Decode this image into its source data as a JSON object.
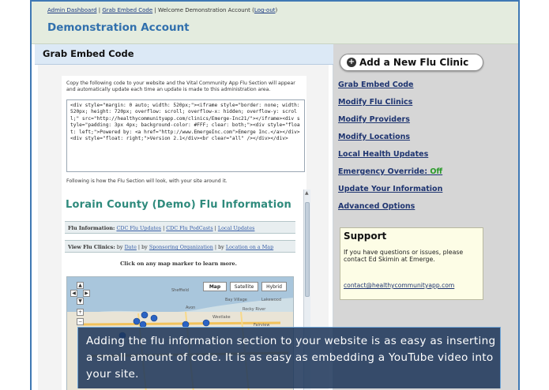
{
  "header": {
    "nav": {
      "admin_dashboard": "Admin Dashboard",
      "separator1": " | ",
      "grab_embed_code": "Grab Embed Code",
      "welcome": " | Welcome Demonstration Account (",
      "logout": "Log-out",
      "close": ")"
    },
    "account_title": "Demonstration Account"
  },
  "main": {
    "title": "Grab Embed Code",
    "instructions": "Copy the following code to your website and the Vital Community App Flu Section will appear and automatically update each time an update is made to this administration area.",
    "embed_code": "<div style=\"margin: 0 auto; width: 520px;\"><iframe style=\"border: none; width: 520px; height: 720px; overflow: scroll; overflow-x: hidden; overflow-y: scroll;\" src=\"http://healthycommunityapp.com/clinics/Emerge-Inc21/\"></iframe><div style=\"padding: 3px 4px; background-color: #FFF; clear: both;\"><div style=\"float: left;\">Powered by: <a href=\"http://www.EmergeInc.com\">Emerge Inc.</a></div><div style=\"float: right;\">Version 2.1</div><br clear=\"all\" /></div></div>",
    "preview_caption": "Following is how the Flu Section will look, with your site around it.",
    "preview": {
      "title": "Lorain County (Demo) Flu Information",
      "info_label": "Flu Information:",
      "info_links": [
        "CDC Flu Updates",
        "CDC Flu PodCasts",
        "Local Updates"
      ],
      "view_label": "View Flu Clinics:",
      "view_by": "by",
      "view_links": [
        "Date",
        "Sponsoring Organization",
        "Location on a Map"
      ],
      "map_hint": "Click on any map marker to learn more.",
      "map_buttons": [
        "Map",
        "Satellite",
        "Hybrid"
      ],
      "map_places": [
        "Sheffield",
        "Bay Village",
        "Lakewood",
        "Avon",
        "Rocky River",
        "Westlake",
        "Fairview"
      ]
    }
  },
  "sidebar": {
    "add_clinic_label": "Add a New Flu Clinic",
    "links": {
      "grab": "Grab Embed Code",
      "modify_clinics": "Modify Flu Clinics",
      "modify_providers": "Modify Providers",
      "modify_locations": "Modify Locations",
      "local_updates": "Local Health Updates",
      "emergency": "Emergency Override:",
      "emergency_status": "Off",
      "update_info": "Update Your Information",
      "advanced": "Advanced Options"
    },
    "support": {
      "title": "Support",
      "text": "If you have questions or issues, please contact Ed Skimin at Emerge.",
      "email": "contact@healthycommunityapp.com"
    }
  },
  "callout": {
    "text": "Adding the flu information section to your website is as easy as inserting a small amount of code. It is as easy as embedding a YouTube video into your site."
  },
  "colors": {
    "account_title": "#3170ad",
    "preview_title": "#2e8a7c",
    "emergency_off": "#2a9a2a",
    "callout_bg": "#1c3458"
  }
}
